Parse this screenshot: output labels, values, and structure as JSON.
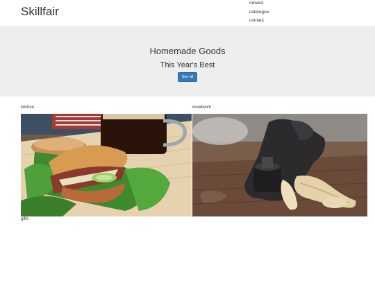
{
  "header": {
    "brand": "Skillfair",
    "nav": [
      "newest",
      "catalogue",
      "contact"
    ]
  },
  "hero": {
    "title": "Homemade Goods",
    "subtitle": "This Year's Best",
    "button_label": "See all"
  },
  "categories": [
    {
      "label": "kitchen",
      "image": "sandwich-and-beer-photo"
    },
    {
      "label": "woodwork",
      "image": "hand-plane-with-wood-shavings-photo"
    },
    {
      "label": "gifts"
    }
  ],
  "colors": {
    "hero_background": "#eeeeee",
    "button": "#337ab7"
  }
}
